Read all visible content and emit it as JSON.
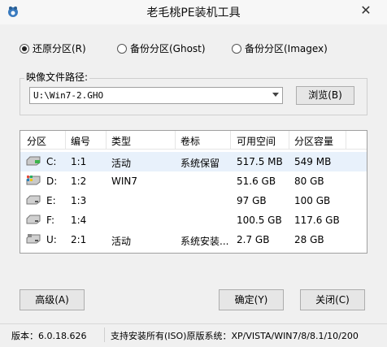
{
  "window": {
    "title": "老毛桃PE装机工具",
    "close_label": "✕"
  },
  "radios": [
    {
      "label": "还原分区(R)",
      "checked": true
    },
    {
      "label": "备份分区(Ghost)",
      "checked": false
    },
    {
      "label": "备份分区(Imagex)",
      "checked": false
    }
  ],
  "image_path": {
    "label": "映像文件路径:",
    "value": "U:\\Win7-2.GHO",
    "browse_label": "浏览(B)"
  },
  "table": {
    "headers": [
      "分区",
      "编号",
      "类型",
      "卷标",
      "可用空间",
      "分区容量"
    ],
    "rows": [
      {
        "part": "C:",
        "num": "1:1",
        "type": "活动",
        "label": "系统保留",
        "free": "517.5 MB",
        "size": "549 MB",
        "icon": "system-drive-icon"
      },
      {
        "part": "D:",
        "num": "1:2",
        "type": "WIN7",
        "label": "",
        "free": "51.6 GB",
        "size": "80 GB",
        "icon": "windows-drive-icon"
      },
      {
        "part": "E:",
        "num": "1:3",
        "type": "",
        "label": "",
        "free": "97 GB",
        "size": "100 GB",
        "icon": "drive-icon"
      },
      {
        "part": "F:",
        "num": "1:4",
        "type": "",
        "label": "",
        "free": "100.5 GB",
        "size": "117.6 GB",
        "icon": "drive-icon"
      },
      {
        "part": "U:",
        "num": "2:1",
        "type": "活动",
        "label": "系统安装...",
        "free": "2.7 GB",
        "size": "28 GB",
        "icon": "usb-drive-icon"
      }
    ]
  },
  "buttons": {
    "advanced": "高级(A)",
    "ok": "确定(Y)",
    "close": "关闭(C)"
  },
  "status": {
    "version": "版本：6.0.18.626",
    "support": "支持安装所有(ISO)原版系统：XP/VISTA/WIN7/8/8.1/10/200"
  },
  "colors": {
    "selected_row": "#e8f1fb",
    "window_bg": "#f0f0f0"
  }
}
